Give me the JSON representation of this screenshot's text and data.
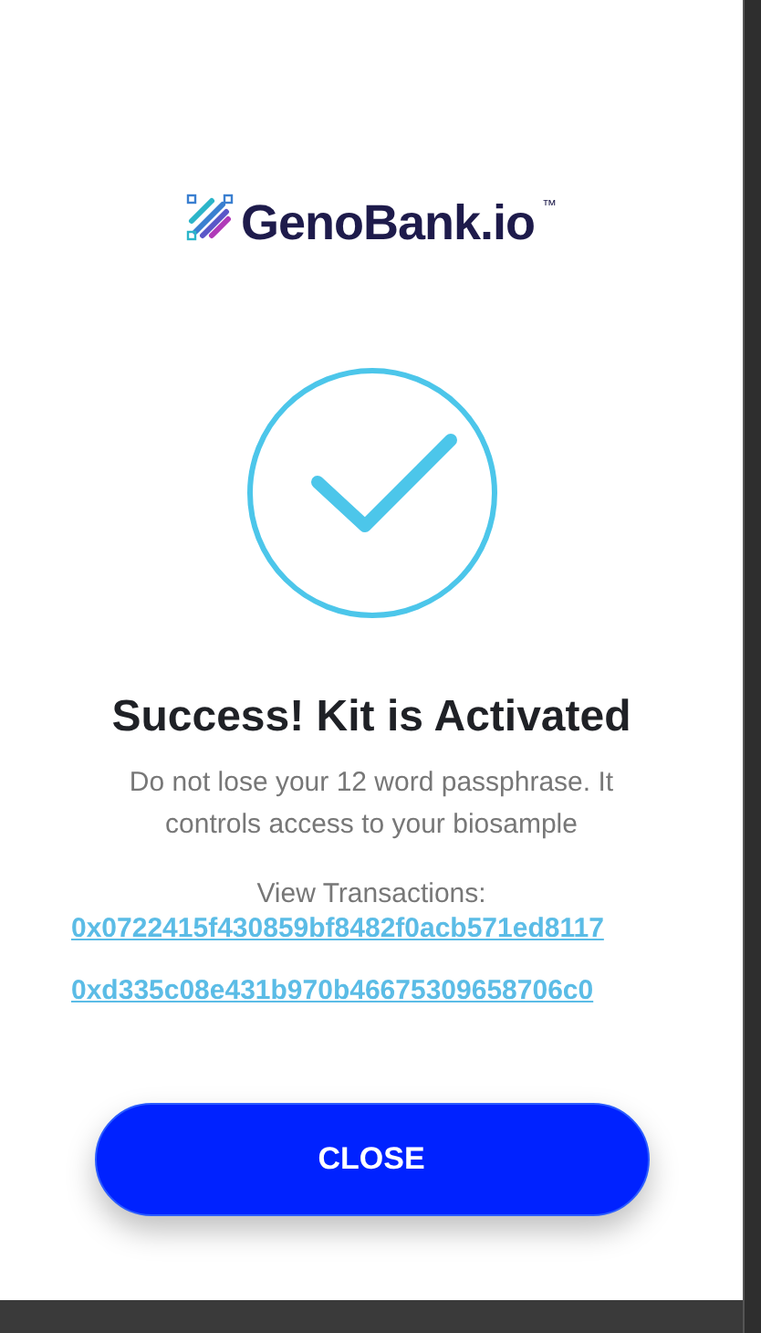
{
  "logo": {
    "text": "GenoBank.io",
    "trademark": "™"
  },
  "title": "Success! Kit is Activated",
  "message": "Do not lose your 12 word passphrase. It controls access to your biosample",
  "transactions_label": "View Transactions:",
  "transactions": [
    "0x0722415f430859bf8482f0acb571ed8117",
    "0xd335c08e431b970b46675309658706c0"
  ],
  "button": "CLOSE"
}
